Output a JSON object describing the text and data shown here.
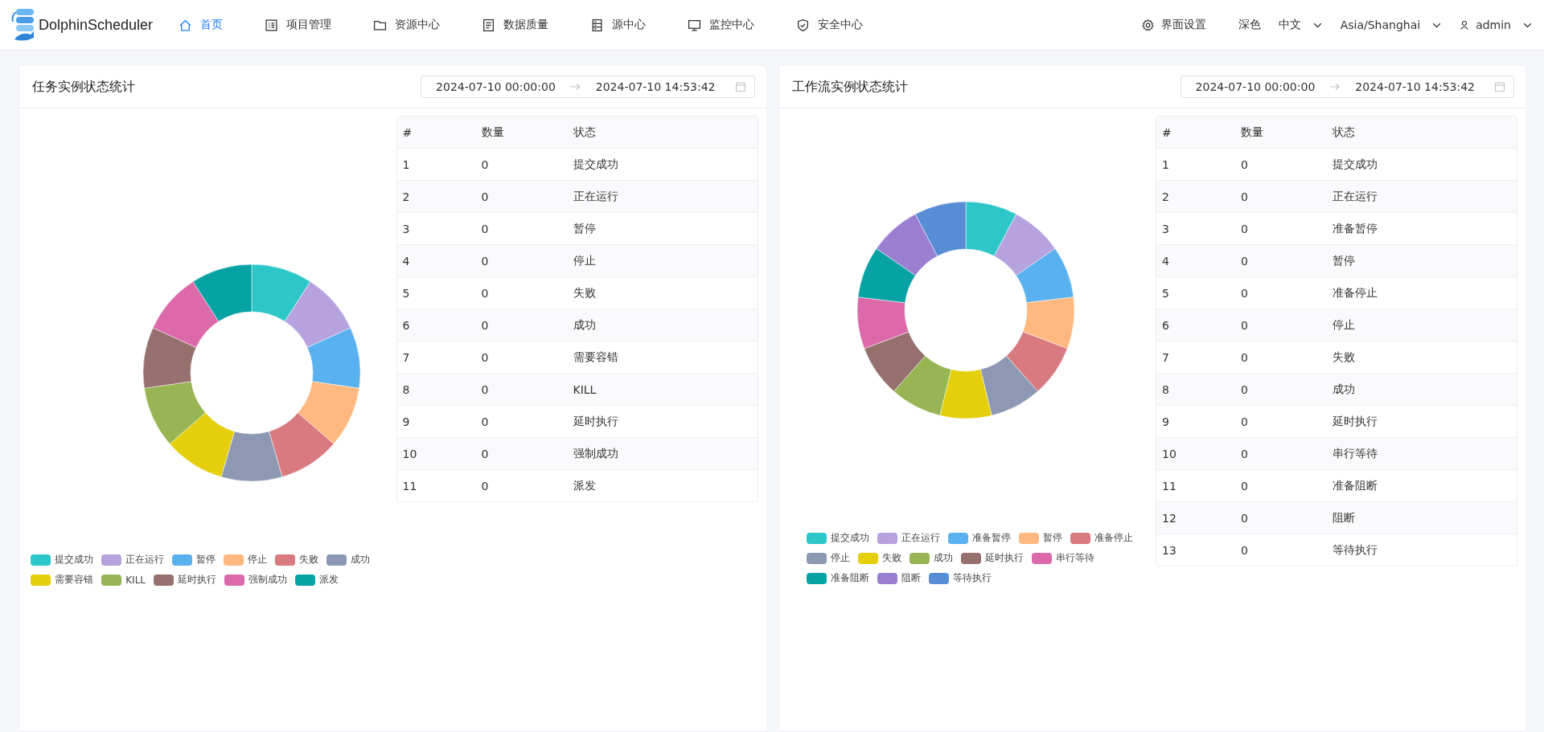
{
  "header": {
    "logo": "DolphinScheduler",
    "nav": [
      {
        "label": "首页",
        "kind": "home",
        "selected": true
      },
      {
        "label": "项目管理",
        "kind": "list",
        "selected": false
      },
      {
        "label": "资源中心",
        "kind": "folder",
        "selected": false
      },
      {
        "label": "数据质量",
        "kind": "doc",
        "selected": false
      },
      {
        "label": "源中心",
        "kind": "server",
        "selected": false
      },
      {
        "label": "监控中心",
        "kind": "monitor",
        "selected": false
      },
      {
        "label": "安全中心",
        "kind": "shield",
        "selected": false
      }
    ],
    "settings": "界面设置",
    "theme": "深色",
    "language": "中文",
    "timezone": "Asia/Shanghai",
    "user": "admin"
  },
  "panels": [
    {
      "title": "任务实例状态统计",
      "start": "2024-07-10 00:00:00",
      "end": "2024-07-10 14:53:42",
      "columns": [
        "#",
        "数量",
        "状态"
      ],
      "rows": [
        [
          "1",
          "0",
          "提交成功"
        ],
        [
          "2",
          "0",
          "正在运行"
        ],
        [
          "3",
          "0",
          "暂停"
        ],
        [
          "4",
          "0",
          "停止"
        ],
        [
          "5",
          "0",
          "失败"
        ],
        [
          "6",
          "0",
          "成功"
        ],
        [
          "7",
          "0",
          "需要容错"
        ],
        [
          "8",
          "0",
          "KILL"
        ],
        [
          "9",
          "0",
          "延时执行"
        ],
        [
          "10",
          "0",
          "强制成功"
        ],
        [
          "11",
          "0",
          "派发"
        ]
      ],
      "legend": [
        {
          "label": "提交成功",
          "color": "#2ec7c9"
        },
        {
          "label": "正在运行",
          "color": "#b6a2de"
        },
        {
          "label": "暂停",
          "color": "#5ab1ef"
        },
        {
          "label": "停止",
          "color": "#ffb980"
        },
        {
          "label": "失败",
          "color": "#d87a80"
        },
        {
          "label": "成功",
          "color": "#8d98b3"
        },
        {
          "label": "需要容错",
          "color": "#e5cf0d"
        },
        {
          "label": "KILL",
          "color": "#97b552"
        },
        {
          "label": "延时执行",
          "color": "#95706d"
        },
        {
          "label": "强制成功",
          "color": "#dc69aa"
        },
        {
          "label": "派发",
          "color": "#07a2a4"
        }
      ]
    },
    {
      "title": "工作流实例状态统计",
      "start": "2024-07-10 00:00:00",
      "end": "2024-07-10 14:53:42",
      "columns": [
        "#",
        "数量",
        "状态"
      ],
      "rows": [
        [
          "1",
          "0",
          "提交成功"
        ],
        [
          "2",
          "0",
          "正在运行"
        ],
        [
          "3",
          "0",
          "准备暂停"
        ],
        [
          "4",
          "0",
          "暂停"
        ],
        [
          "5",
          "0",
          "准备停止"
        ],
        [
          "6",
          "0",
          "停止"
        ],
        [
          "7",
          "0",
          "失败"
        ],
        [
          "8",
          "0",
          "成功"
        ],
        [
          "9",
          "0",
          "延时执行"
        ],
        [
          "10",
          "0",
          "串行等待"
        ],
        [
          "11",
          "0",
          "准备阻断"
        ],
        [
          "12",
          "0",
          "阻断"
        ],
        [
          "13",
          "0",
          "等待执行"
        ]
      ],
      "legend": [
        {
          "label": "提交成功",
          "color": "#2ec7c9"
        },
        {
          "label": "正在运行",
          "color": "#b6a2de"
        },
        {
          "label": "准备暂停",
          "color": "#5ab1ef"
        },
        {
          "label": "暂停",
          "color": "#ffb980"
        },
        {
          "label": "准备停止",
          "color": "#d87a80"
        },
        {
          "label": "停止",
          "color": "#8d98b3"
        },
        {
          "label": "失败",
          "color": "#e5cf0d"
        },
        {
          "label": "成功",
          "color": "#97b552"
        },
        {
          "label": "延时执行",
          "color": "#95706d"
        },
        {
          "label": "串行等待",
          "color": "#dc69aa"
        },
        {
          "label": "准备阻断",
          "color": "#07a2a4"
        },
        {
          "label": "阻断",
          "color": "#9a7fd1"
        },
        {
          "label": "等待执行",
          "color": "#588dd5"
        }
      ]
    }
  ]
}
